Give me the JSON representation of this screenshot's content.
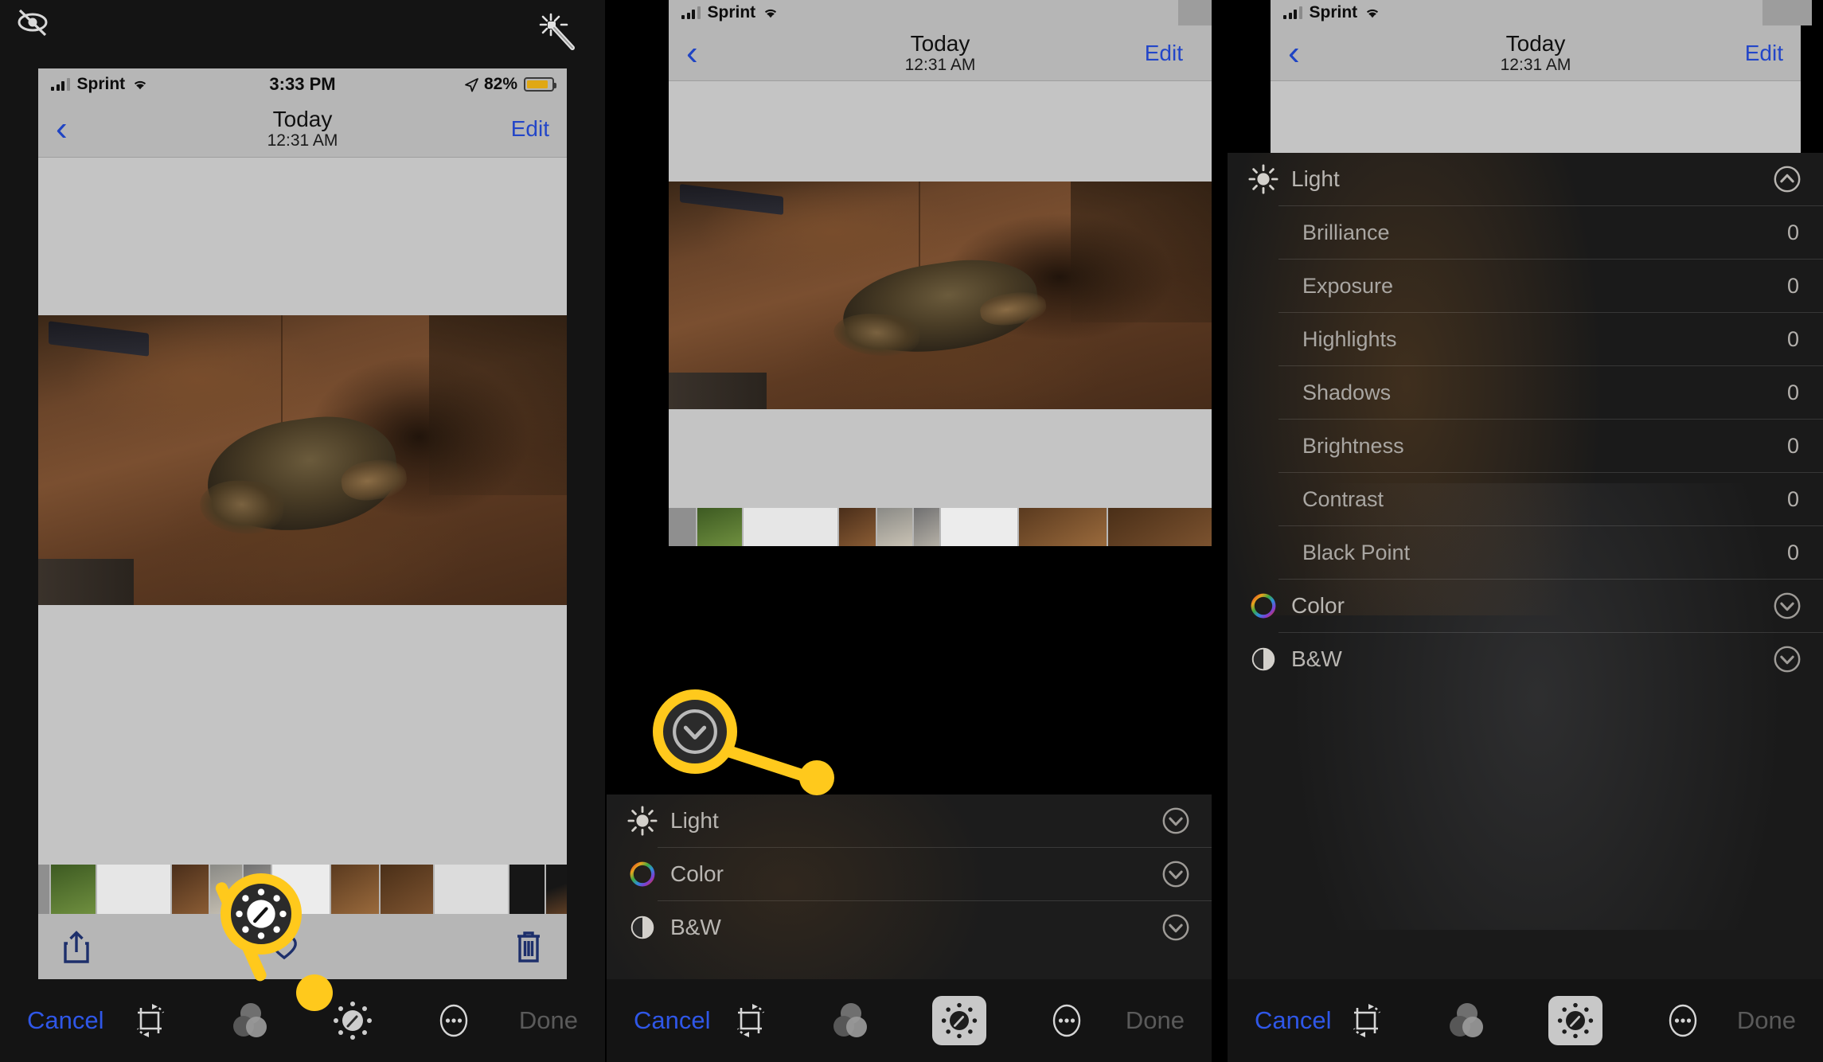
{
  "meta": {
    "app": "iOS Photos Editor",
    "accent_yellow": "#ffc91c",
    "accent_blue": "#2346c8",
    "statusbar_bg": "#b6b6b6",
    "dark_bg": "#141414"
  },
  "top_icons": {
    "hide_label": "eye-slash",
    "magic_label": "magic-wand"
  },
  "panel1": {
    "status": {
      "carrier": "Sprint",
      "time": "3:33 PM",
      "battery_percent": "82%"
    },
    "nav": {
      "back": "‹",
      "title": "Today",
      "subtitle": "12:31 AM",
      "edit": "Edit"
    },
    "actions": {
      "share": "share-icon",
      "favorite": "heart-icon",
      "trash": "trash-icon"
    },
    "toolbar": {
      "cancel": "Cancel",
      "done": "Done",
      "tools": [
        "crop-rotate",
        "filters",
        "adjust",
        "more"
      ]
    },
    "callout": {
      "icon": "adjust-dial-icon",
      "target": "adjust"
    }
  },
  "panel2": {
    "status": {
      "carrier": "Sprint"
    },
    "nav": {
      "back": "‹",
      "title": "Today",
      "subtitle": "12:31 AM",
      "edit": "Edit"
    },
    "adjustments": [
      {
        "label": "Light",
        "icon": "sun-icon",
        "chevron": "chevron-down"
      },
      {
        "label": "Color",
        "icon": "color-wheel-icon",
        "chevron": "chevron-down"
      },
      {
        "label": "B&W",
        "icon": "bw-circle-icon",
        "chevron": "chevron-down"
      }
    ],
    "toolbar": {
      "cancel": "Cancel",
      "done": "Done",
      "tools": [
        "crop-rotate",
        "filters",
        "adjust",
        "more"
      ],
      "selected": "adjust"
    },
    "callout": {
      "icon": "chevron-down-circle-icon",
      "target": "light-expand-chevron"
    }
  },
  "panel3": {
    "status": {
      "carrier": "Sprint"
    },
    "nav": {
      "back": "‹",
      "title": "Today",
      "subtitle": "12:31 AM",
      "edit": "Edit"
    },
    "light_section": {
      "label": "Light",
      "icon": "sun-icon",
      "chevron": "chevron-up",
      "sliders": [
        {
          "label": "Brilliance",
          "value": "0"
        },
        {
          "label": "Exposure",
          "value": "0"
        },
        {
          "label": "Highlights",
          "value": "0"
        },
        {
          "label": "Shadows",
          "value": "0"
        },
        {
          "label": "Brightness",
          "value": "0"
        },
        {
          "label": "Contrast",
          "value": "0"
        },
        {
          "label": "Black Point",
          "value": "0"
        }
      ]
    },
    "adjustments": [
      {
        "label": "Color",
        "icon": "color-wheel-icon",
        "chevron": "chevron-down"
      },
      {
        "label": "B&W",
        "icon": "bw-circle-icon",
        "chevron": "chevron-down"
      }
    ],
    "toolbar": {
      "cancel": "Cancel",
      "done": "Done",
      "tools": [
        "crop-rotate",
        "filters",
        "adjust",
        "more"
      ],
      "selected": "adjust"
    }
  }
}
